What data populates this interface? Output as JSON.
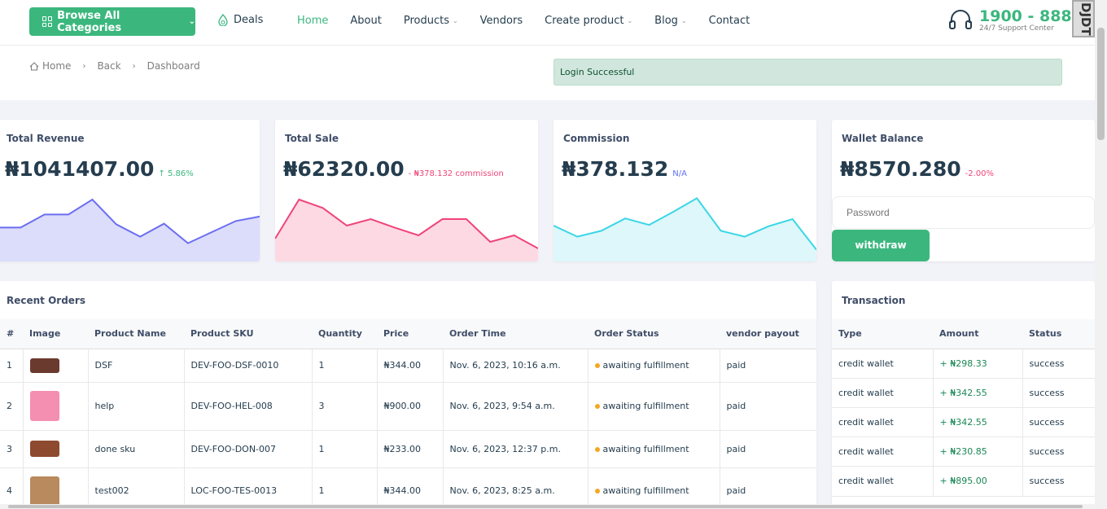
{
  "header": {
    "browse_label": "Browse  All Categories",
    "deals_label": "Deals",
    "nav": [
      {
        "label": "Home",
        "active": true,
        "caret": false
      },
      {
        "label": "About",
        "active": false,
        "caret": false
      },
      {
        "label": "Products",
        "active": false,
        "caret": true
      },
      {
        "label": "Vendors",
        "active": false,
        "caret": false
      },
      {
        "label": "Create product",
        "active": false,
        "caret": true
      },
      {
        "label": "Blog",
        "active": false,
        "caret": true
      },
      {
        "label": "Contact",
        "active": false,
        "caret": false
      }
    ],
    "support_phone": "1900 - 888",
    "support_sub": "24/7 Support Center",
    "side_logo_text": "DJDT"
  },
  "breadcrumb": [
    "Home",
    "Back",
    "Dashboard"
  ],
  "alert": "Login Successful",
  "stats": {
    "revenue": {
      "label": "Total Revenue",
      "amount": "₦1041407.00",
      "change": "↑ 5.86%",
      "change_color": "#3bb77e",
      "line": "#6a6ef0",
      "fill": "#dcdcfb",
      "points": [
        52,
        52,
        72,
        72,
        95,
        57,
        38,
        58,
        28,
        45,
        62,
        69
      ]
    },
    "sale": {
      "label": "Total Sale",
      "amount": "₦62320.00",
      "change": "- ₦378.132 commission",
      "change_color": "#f0447a",
      "line": "#f0447a",
      "fill": "#fdd9e4",
      "points": [
        35,
        95,
        82,
        55,
        65,
        52,
        40,
        65,
        65,
        30,
        40,
        20
      ]
    },
    "commission": {
      "label": "Commission",
      "amount": "₦378.132",
      "change": "N/A",
      "change_color": "#5e6ff3",
      "line": "#3ad6e6",
      "fill": "#ddf7fa",
      "points": [
        55,
        38,
        47,
        66,
        56,
        76,
        97,
        47,
        38,
        54,
        65,
        18
      ]
    },
    "wallet": {
      "label": "Wallet Balance",
      "amount": "₦8570.280",
      "change": "-2.00%",
      "change_color": "#f0447a",
      "password_placeholder": "Password",
      "withdraw_label": "withdraw"
    }
  },
  "orders": {
    "title": "Recent Orders",
    "headers": [
      "#",
      "Image",
      "Product Name",
      "Product SKU",
      "Quantity",
      "Price",
      "Order Time",
      "Order Status",
      "vendor payout"
    ],
    "rows": [
      {
        "n": "1",
        "thumb": "#6b3a2e",
        "name": "DSF",
        "sku": "DEV-FOO-DSF-0010",
        "qty": "1",
        "price": "₦344.00",
        "time": "Nov. 6, 2023, 10:16 a.m.",
        "status": "awaiting fulfillment",
        "payout": "paid"
      },
      {
        "n": "2",
        "thumb": "#f48fb1",
        "name": "help",
        "sku": "DEV-FOO-HEL-008",
        "qty": "3",
        "price": "₦900.00",
        "time": "Nov. 6, 2023, 9:54 a.m.",
        "status": "awaiting fulfillment",
        "payout": "paid"
      },
      {
        "n": "3",
        "thumb": "#8d4a2f",
        "name": "done sku",
        "sku": "DEV-FOO-DON-007",
        "qty": "1",
        "price": "₦233.00",
        "time": "Nov. 6, 2023, 12:37 p.m.",
        "status": "awaiting fulfillment",
        "payout": "paid"
      },
      {
        "n": "4",
        "thumb": "#b98a5e",
        "name": "test002",
        "sku": "LOC-FOO-TES-0013",
        "qty": "1",
        "price": "₦344.00",
        "time": "Nov. 6, 2023, 8:25 a.m.",
        "status": "awaiting fulfillment",
        "payout": "paid"
      }
    ]
  },
  "transactions": {
    "title": "Transaction",
    "headers": [
      "Type",
      "Amount",
      "Status"
    ],
    "rows": [
      {
        "type": "credit wallet",
        "amount": "+ ₦298.33",
        "status": "success"
      },
      {
        "type": "credit wallet",
        "amount": "+ ₦342.55",
        "status": "success"
      },
      {
        "type": "credit wallet",
        "amount": "+ ₦342.55",
        "status": "success"
      },
      {
        "type": "credit wallet",
        "amount": "+ ₦230.85",
        "status": "success"
      },
      {
        "type": "credit wallet",
        "amount": "+ ₦895.00",
        "status": "success"
      }
    ]
  }
}
